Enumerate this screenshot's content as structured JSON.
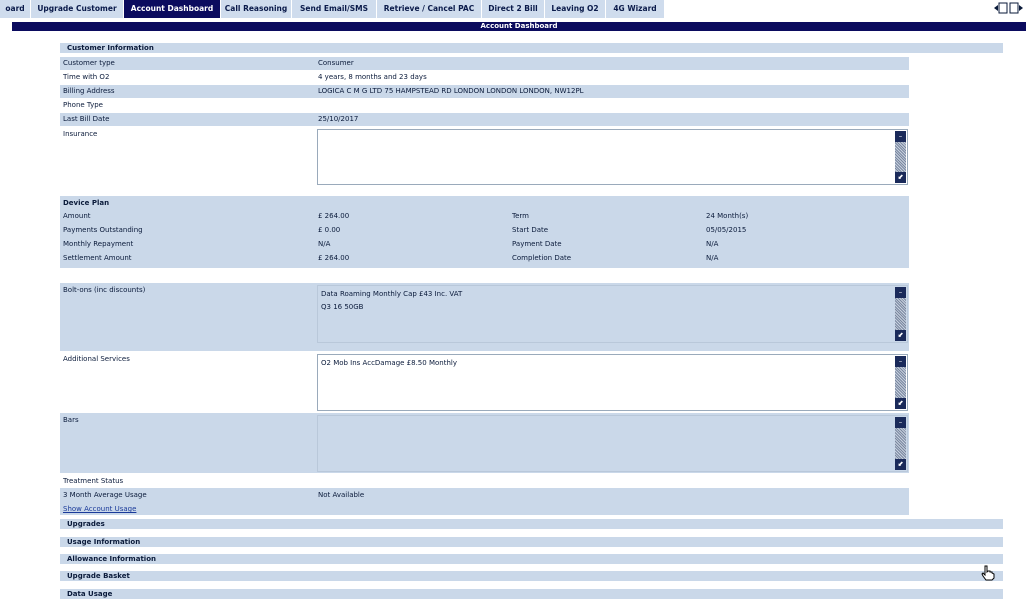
{
  "tabs": [
    {
      "label": "oard",
      "active": false
    },
    {
      "label": "Upgrade Customer",
      "active": false
    },
    {
      "label": "Account Dashboard",
      "active": true
    },
    {
      "label": "Call Reasoning",
      "active": false
    },
    {
      "label": "Send Email/SMS",
      "active": false
    },
    {
      "label": "Retrieve / Cancel PAC",
      "active": false
    },
    {
      "label": "Direct 2 Bill",
      "active": false
    },
    {
      "label": "Leaving O2",
      "active": false
    },
    {
      "label": "4G Wizard",
      "active": false
    }
  ],
  "dashboard_title": "Account Dashboard",
  "customer_info": {
    "header": "Customer Information",
    "rows": [
      {
        "label": "Customer type",
        "value": "Consumer"
      },
      {
        "label": "Time with O2",
        "value": "4 years, 8 months and 23 days"
      },
      {
        "label": "Billing Address",
        "value": "LOGICA C M G LTD 75 HAMPSTEAD RD LONDON LONDON LONDON, NW12PL"
      },
      {
        "label": "Phone Type",
        "value": ""
      },
      {
        "label": "Last Bill Date",
        "value": "25/10/2017"
      }
    ],
    "insurance_label": "Insurance"
  },
  "device_plan": {
    "title": "Device Plan",
    "rows": [
      {
        "label": "Amount",
        "value": "£ 264.00",
        "label2": "Term",
        "value2": "24 Month(s)"
      },
      {
        "label": "Payments Outstanding",
        "value": "£ 0.00",
        "label2": "Start Date",
        "value2": "05/05/2015"
      },
      {
        "label": "Monthly Repayment",
        "value": "N/A",
        "label2": "Payment Date",
        "value2": "N/A"
      },
      {
        "label": "Settlement Amount",
        "value": "£ 264.00",
        "label2": "Completion Date",
        "value2": "N/A"
      }
    ]
  },
  "bolt_ons": {
    "label": "Bolt-ons (inc discounts)",
    "items": [
      "Data Roaming Monthly Cap £43 Inc. VAT",
      "Q3 16 50GB"
    ]
  },
  "additional_services": {
    "label": "Additional Services",
    "items": [
      "O2 Mob Ins AccDamage £8.50 Monthly"
    ]
  },
  "bars": {
    "label": "Bars"
  },
  "treatment": {
    "status_label": "Treatment Status",
    "usage_label": "3 Month Average Usage",
    "usage_value": "Not Available",
    "show_usage_link": "Show Account Usage"
  },
  "sections": [
    {
      "label": "Upgrades"
    },
    {
      "label": "Usage Information"
    },
    {
      "label": "Allowance Information"
    },
    {
      "label": "Upgrade Basket"
    },
    {
      "label": "Data Usage"
    }
  ],
  "colors": {
    "navy": "#0b0b5e",
    "panel": "#cad8e9",
    "tab": "#cfdced"
  }
}
